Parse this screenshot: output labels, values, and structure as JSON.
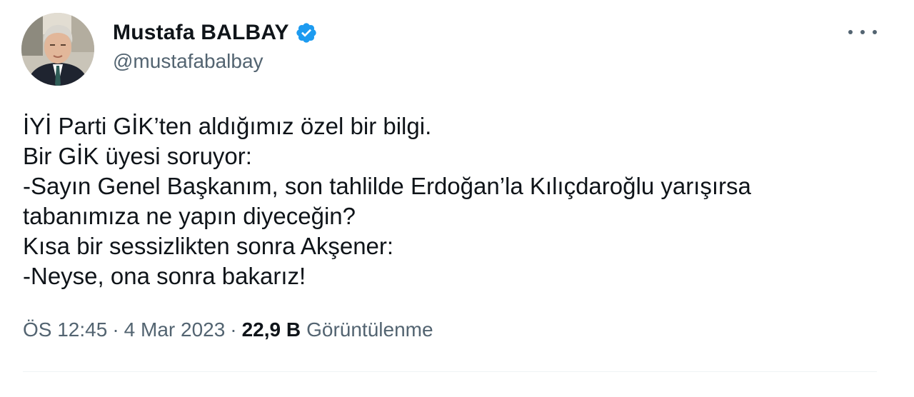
{
  "author": {
    "display_name": "Mustafa BALBAY",
    "handle": "@mustafabalbay",
    "verified": true
  },
  "tweet": {
    "lines": [
      "İYİ Parti GİK’ten aldığımız özel bir bilgi.",
      "Bir GİK üyesi soruyor:",
      "-Sayın Genel Başkanım, son tahlilde Erdoğan’la Kılıçdaroğlu yarışırsa",
      "tabanımıza ne yapın diyeceğin?",
      "Kısa bir sessizlikten sonra Akşener:",
      "-Neyse, ona sonra bakarız!"
    ]
  },
  "meta": {
    "time": "ÖS 12:45",
    "separator": "·",
    "date": "4 Mar 2023",
    "views_count": "22,9 B",
    "views_label": "Görüntülenme"
  },
  "colors": {
    "verified": "#1d9bf0",
    "text_primary": "#0f1419",
    "text_secondary": "#536471",
    "divider": "#eff3f4"
  },
  "icons": {
    "verified": "verified-badge-icon",
    "more": "more-options-icon"
  }
}
